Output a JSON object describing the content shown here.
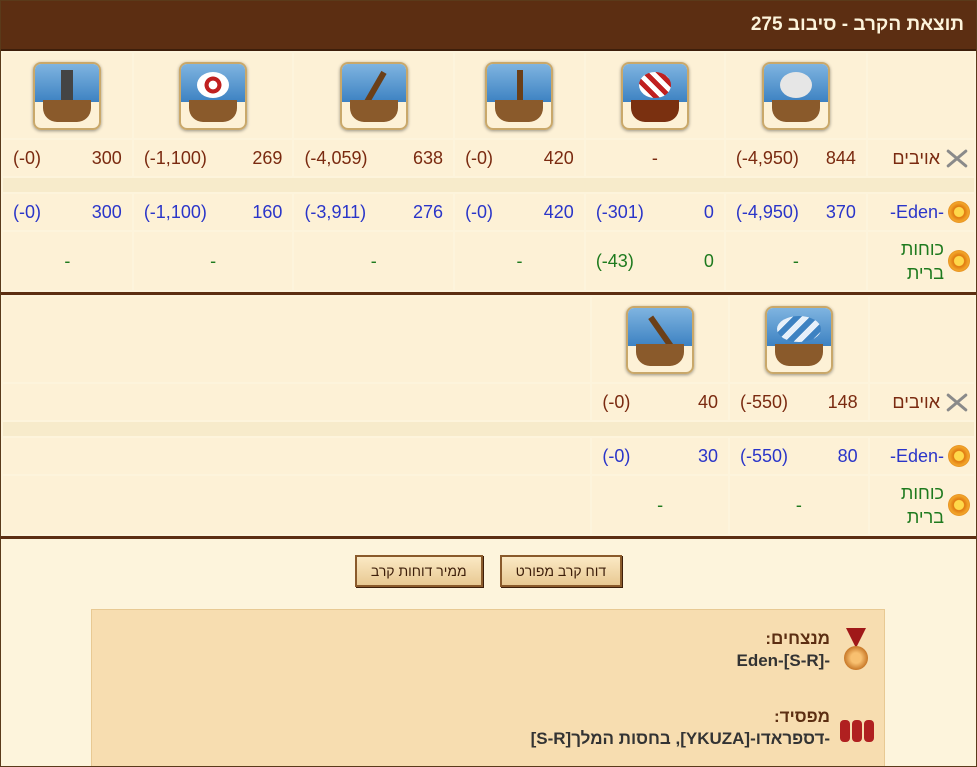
{
  "window": {
    "title": "תוצאת הקרב - סיבוב 275"
  },
  "labels": {
    "enemies": "אויבים",
    "eden": "-Eden-",
    "ally1": "כוחות",
    "ally2": "ברית"
  },
  "section1": {
    "units": [
      "ship-ram",
      "ship-fire",
      "ship-paddle",
      "ship-catapult",
      "ship-ballista",
      "ship-mortar"
    ],
    "enemies": [
      {
        "count": "844",
        "loss": "(-4,950)"
      },
      {
        "count": "",
        "loss": "",
        "dash": "-"
      },
      {
        "count": "420",
        "loss": "(-0)"
      },
      {
        "count": "638",
        "loss": "(-4,059)"
      },
      {
        "count": "269",
        "loss": "(-1,100)"
      },
      {
        "count": "300",
        "loss": "(-0)"
      }
    ],
    "eden": [
      {
        "count": "370",
        "loss": "(-4,950)"
      },
      {
        "count": "0",
        "loss": "(-301)"
      },
      {
        "count": "420",
        "loss": "(-0)"
      },
      {
        "count": "276",
        "loss": "(-3,911)"
      },
      {
        "count": "160",
        "loss": "(-1,100)"
      },
      {
        "count": "300",
        "loss": "(-0)"
      }
    ],
    "ally": [
      {
        "dash": "-"
      },
      {
        "count": "0",
        "loss": "(-43)"
      },
      {
        "dash": "-"
      },
      {
        "dash": "-"
      },
      {
        "dash": "-"
      },
      {
        "dash": "-"
      }
    ]
  },
  "section2": {
    "units": [
      "ship-balloon",
      "ship-crane"
    ],
    "enemies": [
      {
        "count": "148",
        "loss": "(-550)"
      },
      {
        "count": "40",
        "loss": "(-0)"
      }
    ],
    "eden": [
      {
        "count": "80",
        "loss": "(-550)"
      },
      {
        "count": "30",
        "loss": "(-0)"
      }
    ],
    "ally": [
      {
        "dash": "-"
      },
      {
        "dash": "-"
      }
    ]
  },
  "buttons": {
    "detailed": "דוח קרב מפורט",
    "converter": "ממיר דוחות קרב"
  },
  "result": {
    "winners_label": "מנצחים:",
    "winners": "-Eden-[S-R]",
    "loser_label": "מפסיד:",
    "loser": "-דספראדו-[YKUZA], בחסות המלך[S-R]"
  }
}
